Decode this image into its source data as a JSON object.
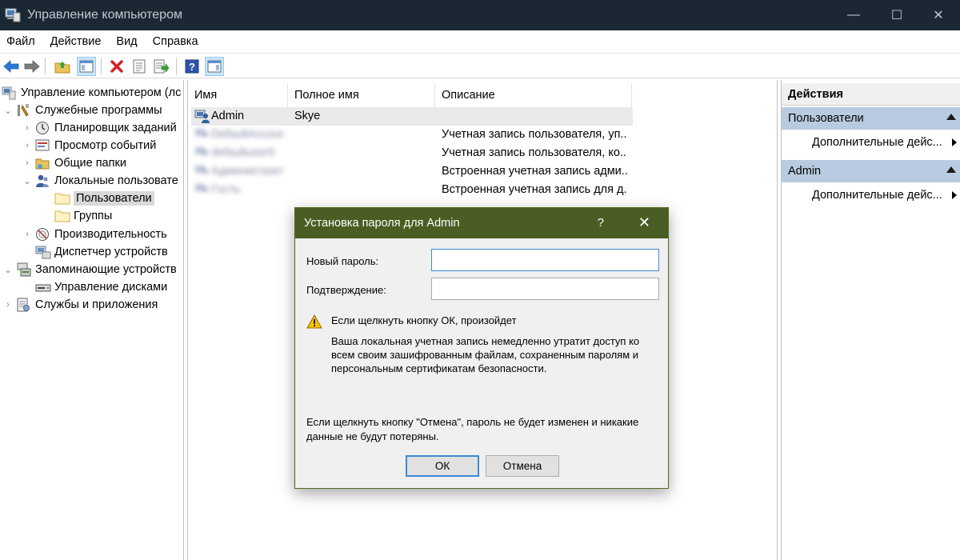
{
  "window": {
    "title": "Управление компьютером",
    "minimize": "—",
    "maximize": "☐",
    "close": "✕"
  },
  "menu": [
    "Файл",
    "Действие",
    "Вид",
    "Справка"
  ],
  "toolbar": {
    "icons": [
      "back-arrow-icon",
      "forward-arrow-icon",
      "up-folder-icon",
      "show-hide-tree-icon",
      "delete-icon",
      "properties-icon",
      "export-list-icon",
      "help-icon",
      "show-hide-actions-icon"
    ]
  },
  "tree": {
    "root": "Управление компьютером (лс",
    "items": [
      {
        "label": "Служебные программы"
      },
      {
        "label": "Планировщик заданий"
      },
      {
        "label": "Просмотр событий"
      },
      {
        "label": "Общие папки"
      },
      {
        "label": "Локальные пользовате"
      },
      {
        "label": "Пользователи"
      },
      {
        "label": "Группы"
      },
      {
        "label": "Производительность"
      },
      {
        "label": "Диспетчер устройств"
      },
      {
        "label": "Запоминающие устройств"
      },
      {
        "label": "Управление дисками"
      },
      {
        "label": "Службы и приложения"
      }
    ]
  },
  "list": {
    "columns": [
      "Имя",
      "Полное имя",
      "Описание"
    ],
    "rows": [
      {
        "name": "Admin",
        "fullname": "Skye",
        "description": ""
      },
      {
        "name": "DefaultAccount",
        "fullname": "",
        "description": "Учетная запись пользователя, уп..."
      },
      {
        "name": "defaultuser0",
        "fullname": "",
        "description": "Учетная запись пользователя, ко..."
      },
      {
        "name": "Администратор",
        "fullname": "",
        "description": "Встроенная учетная запись адми..."
      },
      {
        "name": "Гость",
        "fullname": "",
        "description": "Встроенная учетная запись для д..."
      }
    ]
  },
  "actions": {
    "header": "Действия",
    "sections": [
      {
        "title": "Пользователи",
        "item": "Дополнительные дейс..."
      },
      {
        "title": "Admin",
        "item": "Дополнительные дейс..."
      }
    ]
  },
  "dialog": {
    "title": "Установка пароля для Admin",
    "help": "?",
    "close": "✕",
    "new_password_label": "Новый пароль:",
    "new_password_value": "",
    "confirm_label": "Подтверждение:",
    "confirm_value": "",
    "warning_heading": "Если щелкнуть кнопку ОК, произойдет",
    "warning_line1": "Ваша локальная учетная запись немедленно утратит доступ ко",
    "warning_line2": "всем своим зашифрованным файлам, сохраненным паролям и",
    "warning_line3": "персональным сертификатам безопасности.",
    "cancel_note_line1": "Если щелкнуть кнопку \"Отмена\", пароль не будет изменен и никакие",
    "cancel_note_line2": "данные не будут потеряны.",
    "ok_label": "ОК",
    "cancel_label": "Отмена",
    "title_bar_color": "#4a5d23"
  }
}
